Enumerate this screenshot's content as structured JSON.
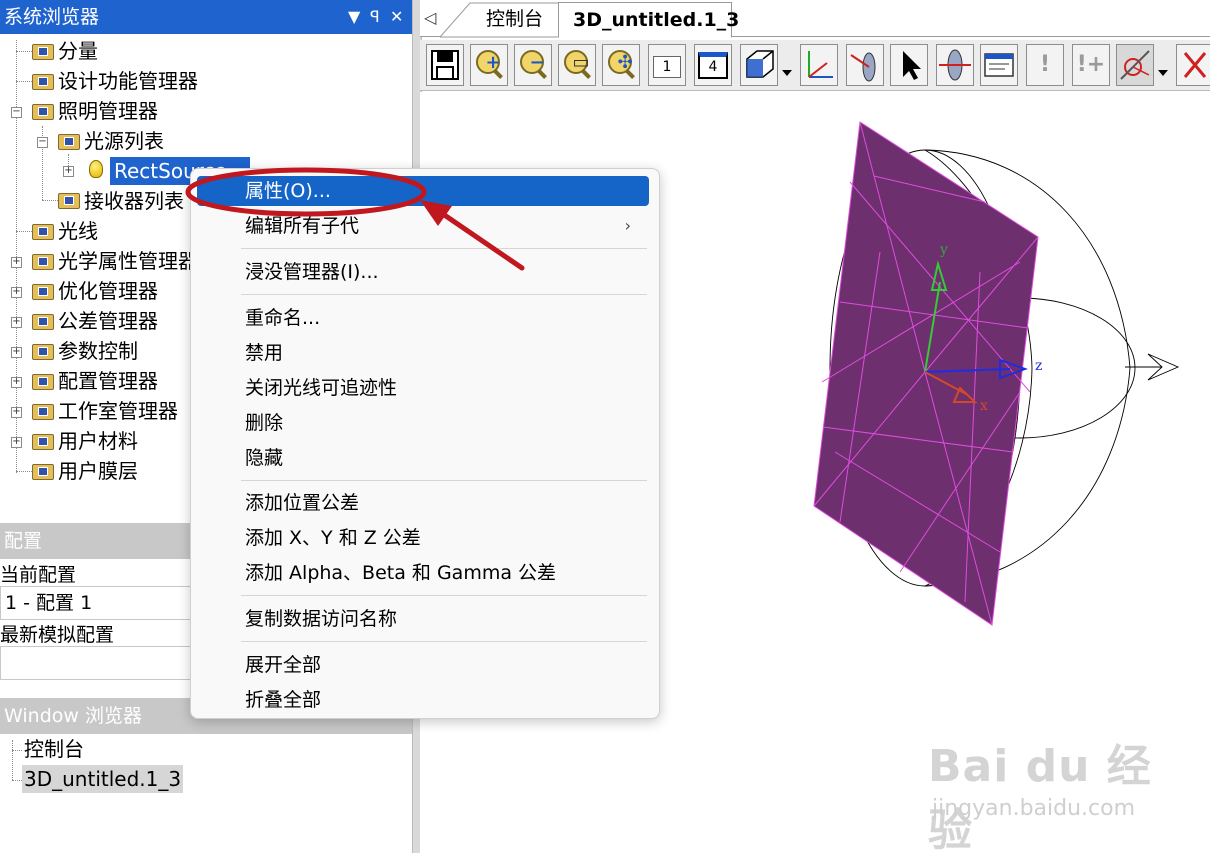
{
  "system_browser": {
    "title": "系统浏览器",
    "pin_icon": "▾ ꟼ ✕",
    "tree": [
      {
        "label": "分量"
      },
      {
        "label": "设计功能管理器"
      },
      {
        "label": "照明管理器"
      },
      {
        "label": "光源列表"
      },
      {
        "label": "RectSource"
      },
      {
        "label": "接收器列表"
      },
      {
        "label": "光线"
      },
      {
        "label": "光学属性管理器"
      },
      {
        "label": "优化管理器"
      },
      {
        "label": "公差管理器"
      },
      {
        "label": "参数控制"
      },
      {
        "label": "配置管理器"
      },
      {
        "label": "工作室管理器"
      },
      {
        "label": "用户材料"
      },
      {
        "label": "用户膜层"
      }
    ]
  },
  "config_panel": {
    "title": "配置",
    "current_label": "当前配置",
    "current_value": "1 - 配置 1",
    "latest_label": "最新模拟配置",
    "latest_value": ""
  },
  "window_browser": {
    "title": "Window 浏览器",
    "items": [
      "控制台",
      "3D_untitled.1_3"
    ]
  },
  "tabs": {
    "console": "控制台",
    "active": "3D_untitled.1_3"
  },
  "toolbar": {
    "buttons": [
      "save-icon",
      "zoom-in-icon",
      "zoom-out-icon",
      "zoom-window-icon",
      "zoom-fit-icon",
      "view-1-icon",
      "view-4-icon",
      "cube-view-icon",
      "axes-icon",
      "lens-icon",
      "pointer-icon",
      "lens-trace-icon",
      "window-icon",
      "exclaim-icon",
      "exclaim-plus-icon",
      "trace-icon",
      "delete-icon"
    ],
    "view1_label": "1",
    "view4_label": "4"
  },
  "viewport": {
    "axis_y": "y",
    "axis_z": "z",
    "axis_x": "x",
    "plane_color": "#6d2f6d",
    "mesh_color": "#e04ce0"
  },
  "context_menu": {
    "items": [
      {
        "label": "属性(O)...",
        "selected": true
      },
      {
        "label": "编辑所有子代",
        "submenu": true
      },
      {
        "label": "浸没管理器(I)..."
      },
      {
        "label": "重命名..."
      },
      {
        "label": "禁用"
      },
      {
        "label": "关闭光线可追迹性"
      },
      {
        "label": "删除"
      },
      {
        "label": "隐藏"
      },
      {
        "label": "添加位置公差"
      },
      {
        "label": "添加 X、Y 和 Z 公差"
      },
      {
        "label": "添加 Alpha、Beta 和 Gamma 公差"
      },
      {
        "label": "复制数据访问名称"
      },
      {
        "label": "展开全部"
      },
      {
        "label": "折叠全部"
      }
    ],
    "submenu_arrow": "›"
  },
  "watermark": {
    "brand": "Bai du 经验",
    "url": "jingyan.baidu.com"
  },
  "colors": {
    "title_blue": "#1f63cf",
    "menu_selected": "#1565c8",
    "annotation_red": "#c0181e"
  }
}
